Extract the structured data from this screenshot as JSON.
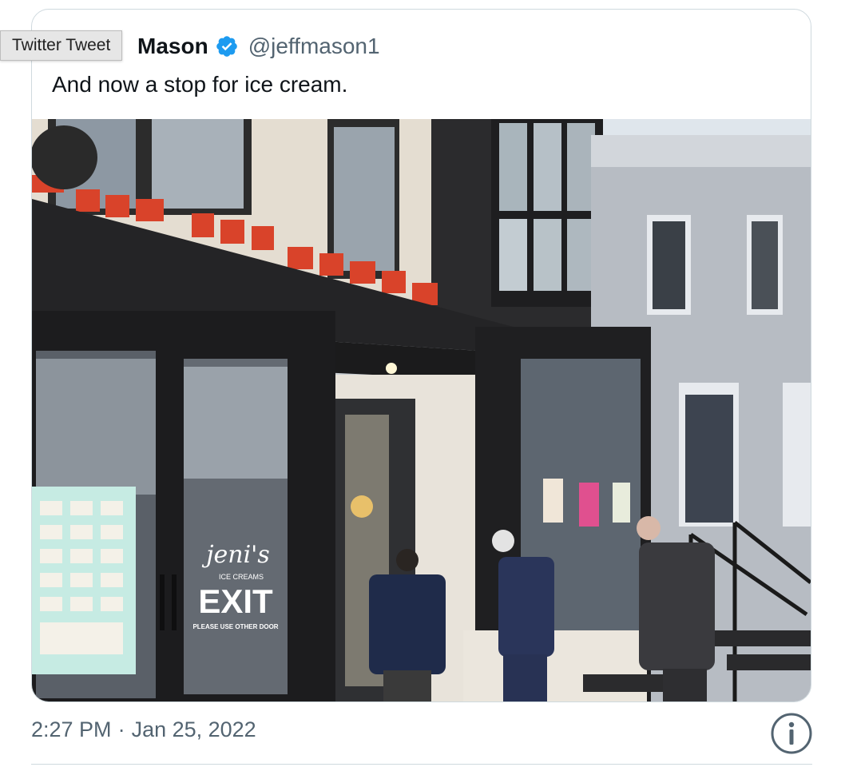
{
  "tooltip": {
    "text": "Twitter Tweet"
  },
  "tweet": {
    "author_name": "Jeff Mason",
    "author_name_visible": "Mason",
    "handle": "@jeffmason1",
    "verified": true,
    "text": "And now a stop for ice cream.",
    "time": "2:27 PM",
    "separator": "·",
    "date": "Jan 25, 2022"
  },
  "photo": {
    "sign_text": "JENI'S ICE CREAMS",
    "door_logo": "jeni's",
    "door_logo_sub": "ICE CREAMS",
    "door_exit": "EXIT",
    "door_exit_sub": "PLEASE USE OTHER DOOR"
  },
  "icons": {
    "verified": "verified-badge-icon",
    "info": "info-icon"
  },
  "colors": {
    "text_primary": "#0f1419",
    "text_secondary": "#536471",
    "verified_blue": "#1d9bf0",
    "border": "#cfd9de"
  }
}
